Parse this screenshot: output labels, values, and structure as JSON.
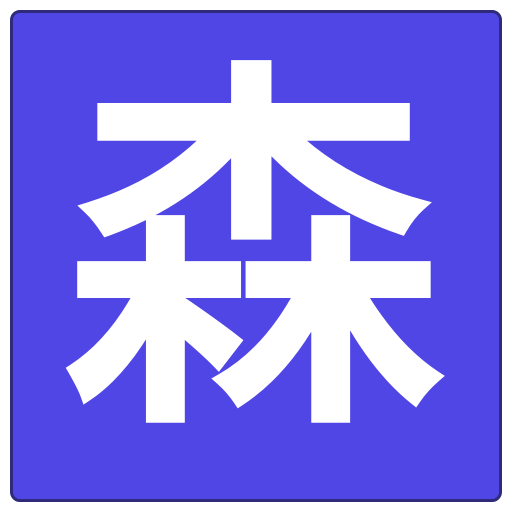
{
  "icon": {
    "character": "森",
    "colors": {
      "tile_background": "#4f46e5",
      "tile_border": "#2f2b7a",
      "glyph": "#ffffff",
      "outer_background": "#ffffff"
    }
  }
}
